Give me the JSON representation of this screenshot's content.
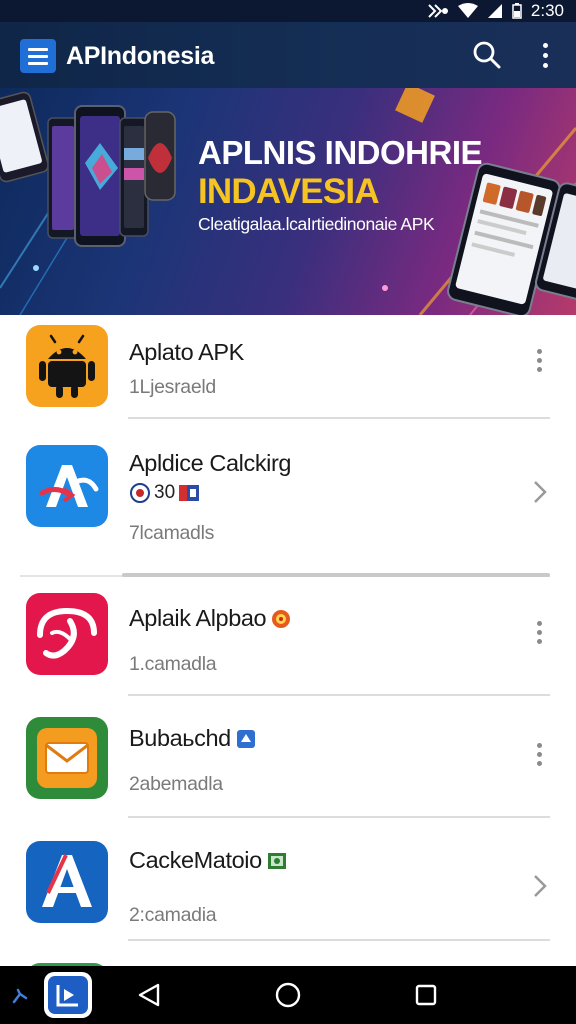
{
  "status_bar": {
    "time": "2:30"
  },
  "app_bar": {
    "title": "APIndonesia",
    "menu_icon": "hamburger-menu-icon",
    "search_icon": "search-icon",
    "more_icon": "more-vert-icon"
  },
  "banner": {
    "title": "APLNIS INDOHRIE",
    "subtitle": "INDAVESIA",
    "caption": "Cleatigalaa.lcaIrtiedinonaie APK",
    "accent_color": "#f5c423"
  },
  "apps": [
    {
      "name": "Aplato APK",
      "subtitle": "1Ljesraeld",
      "icon": "android-robot-icon",
      "icon_color": "#f6a21e",
      "action": "more"
    },
    {
      "name": "Apldice Calckirg",
      "meta": "30",
      "subtitle": "7lcamadls",
      "icon": "arrows-sync-icon",
      "icon_color": "#1e88e5",
      "action": "chevron"
    },
    {
      "name": "Aplaik Alpbao",
      "subtitle": "1.camadla",
      "icon": "phone-swirl-icon",
      "icon_color": "#e3174b",
      "action": "more"
    },
    {
      "name": "Bubaьchd",
      "subtitle": "2abemadla",
      "icon": "envelope-icon",
      "icon_color": "#2e8b3a",
      "action": "more"
    },
    {
      "name": "CackeMatoio",
      "subtitle": "2:camadia",
      "icon": "letter-a-icon",
      "icon_color": "#1565c0",
      "action": "chevron"
    }
  ],
  "nav_bar": {
    "back_icon": "back-triangle-icon",
    "home_icon": "home-circle-icon",
    "recents_icon": "recents-square-icon"
  }
}
